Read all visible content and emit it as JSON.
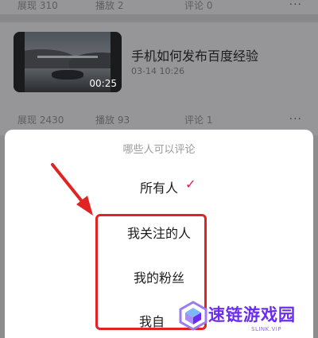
{
  "top_stats": {
    "views": "展现 310",
    "plays": "播放 2",
    "comments": "评论 0",
    "more": "···"
  },
  "video": {
    "title": "手机如何发布百度经验",
    "date": "03-14 10:26",
    "duration": "00:25",
    "views": "展现 2430",
    "plays": "播放 93",
    "comments": "评论 1",
    "more": "···"
  },
  "sheet": {
    "title": "哪些人可以评论",
    "options": [
      {
        "label": "所有人",
        "selected": true
      },
      {
        "label": "我关注的人",
        "selected": false
      },
      {
        "label": "我的粉丝",
        "selected": false
      },
      {
        "label": "我自",
        "selected": false
      }
    ],
    "check_mark": "✓"
  },
  "watermark": {
    "name": "速链游戏园",
    "sub": "SLINK.VIP"
  },
  "colors": {
    "accent": "#d4234e",
    "highlight": "#e02424",
    "watermark": "#6a2df0"
  }
}
